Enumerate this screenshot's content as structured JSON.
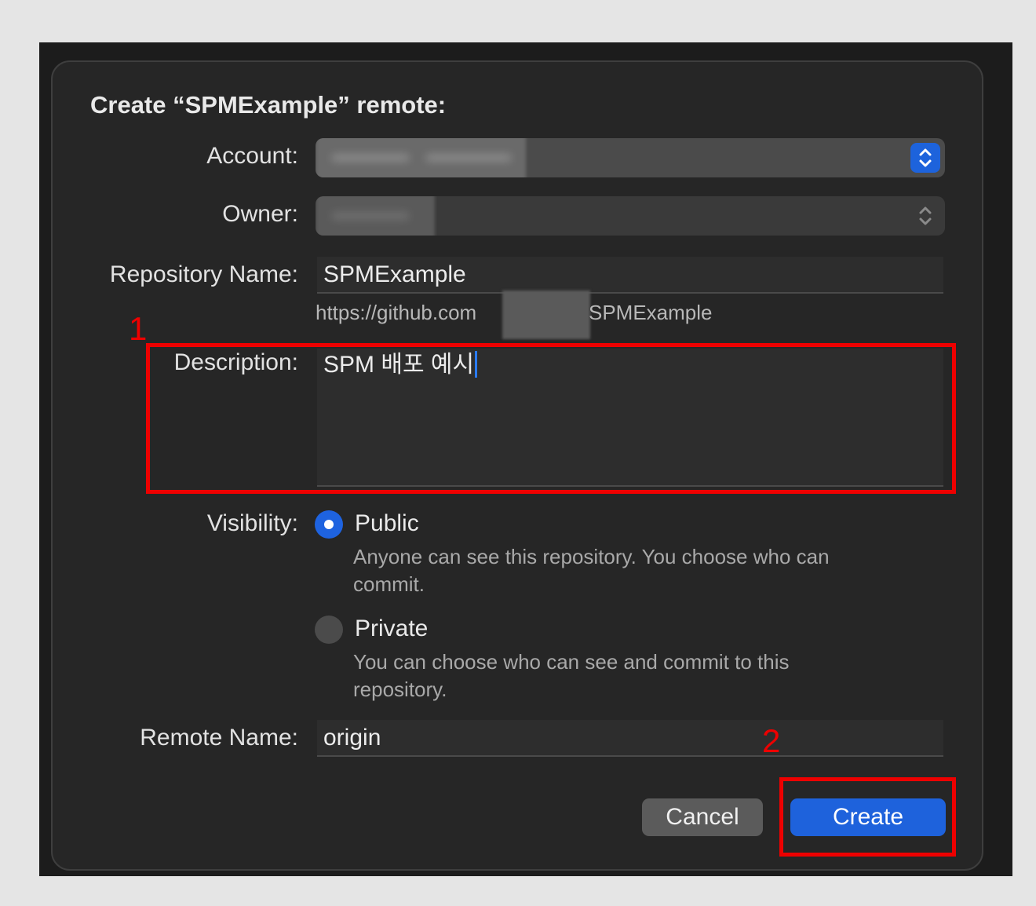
{
  "dialog": {
    "title": "Create “SPMExample” remote:"
  },
  "labels": {
    "account": "Account:",
    "owner": "Owner:",
    "repository_name": "Repository Name:",
    "description": "Description:",
    "visibility": "Visibility:",
    "remote_name": "Remote Name:"
  },
  "fields": {
    "repository_name": "SPMExample",
    "url_prefix": "https://github.com",
    "url_suffix": "SPMExample",
    "description": "SPM 배포 예시",
    "remote_name": "origin"
  },
  "visibility": {
    "selected": "public",
    "public_title": "Public",
    "public_desc": "Anyone can see this repository. You choose who can commit.",
    "private_title": "Private",
    "private_desc": "You can choose who can see and commit to this repository."
  },
  "buttons": {
    "cancel": "Cancel",
    "create": "Create"
  },
  "annotations": {
    "one": "1",
    "two": "2"
  },
  "colors": {
    "accent": "#1e62dc",
    "annotation": "#ee0000",
    "dialog_bg": "#262626"
  },
  "icons": {
    "account_popup": "up-down-chevron-icon",
    "owner_popup": "up-down-chevron-icon",
    "public_radio": "radio-selected-icon",
    "private_radio": "radio-unselected-icon"
  }
}
